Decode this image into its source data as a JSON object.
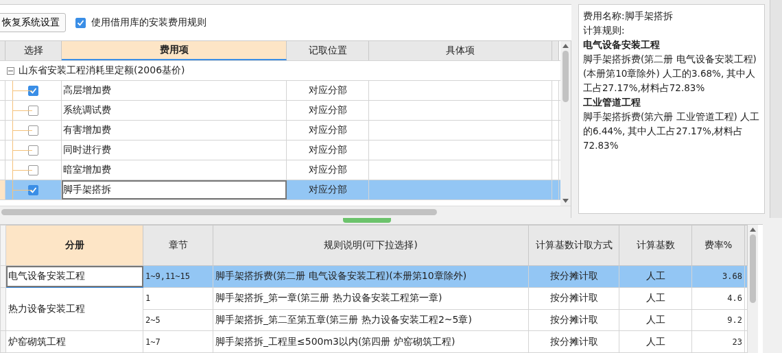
{
  "toolbar": {
    "restore_button": "恢复系统设置",
    "use_library_rules": {
      "label": "使用借用库的安装费用规则",
      "checked": true
    }
  },
  "fee_table": {
    "columns": [
      "选择",
      "费用项",
      "记取位置",
      "具体项"
    ],
    "group": {
      "label": "山东省安装工程消耗里定额(2006基价)",
      "expanded": true,
      "children": [
        {
          "name": "高层增加费",
          "checked": true,
          "location": "对应分部",
          "selected": false
        },
        {
          "name": "系统调试费",
          "checked": false,
          "location": "对应分部",
          "selected": false
        },
        {
          "name": "有害增加费",
          "checked": false,
          "location": "对应分部",
          "selected": false
        },
        {
          "name": "同时进行费",
          "checked": false,
          "location": "对应分部",
          "selected": false
        },
        {
          "name": "暗室增加费",
          "checked": false,
          "location": "对应分部",
          "selected": false
        },
        {
          "name": "脚手架搭拆",
          "checked": true,
          "location": "对应分部",
          "selected": true
        }
      ]
    }
  },
  "info": {
    "name_line": "费用名称:脚手架搭拆",
    "rule_label": "计算规则:",
    "sections": [
      {
        "heading": "电气设备安装工程",
        "text": "脚手架搭拆费(第二册 电气设备安装工程)(本册第10章除外) 人工的3.68%, 其中人工占27.17%,材料占72.83%"
      },
      {
        "heading": "工业管道工程",
        "text": "脚手架搭拆费(第六册 工业管道工程) 人工的6.44%, 其中人工占27.17%,材料占72.83%"
      }
    ]
  },
  "rules_table": {
    "columns": [
      "分册",
      "章节",
      "规则说明(可下拉选择)",
      "计算基数计取方式",
      "计算基数",
      "费率%"
    ],
    "groups": [
      {
        "volume": "电气设备安装工程",
        "rows": [
          {
            "chapter": "1~9,11~15",
            "rule": "脚手架搭拆费(第二册 电气设备安装工程)(本册第10章除外)",
            "method": "按分摊计取",
            "base": "人工",
            "rate": "3.68",
            "selected": true
          }
        ]
      },
      {
        "volume": "热力设备安装工程",
        "rows": [
          {
            "chapter": "1",
            "rule": "脚手架搭拆_第一章(第三册 热力设备安装工程第一章)",
            "method": "按分摊计取",
            "base": "人工",
            "rate": "4.6",
            "selected": false
          },
          {
            "chapter": "2~5",
            "rule": "脚手架搭拆_第二至第五章(第三册 热力设备安装工程2~5章)",
            "method": "按分摊计取",
            "base": "人工",
            "rate": "9.2",
            "selected": false
          }
        ]
      },
      {
        "volume": "炉窑砌筑工程",
        "rows": [
          {
            "chapter": "1~7",
            "rule": "脚手架搭拆_工程里≤500m3以内(第四册 炉窑砌筑工程)",
            "method": "按分摊计取",
            "base": "人工",
            "rate": "23",
            "selected": false
          }
        ]
      }
    ]
  }
}
